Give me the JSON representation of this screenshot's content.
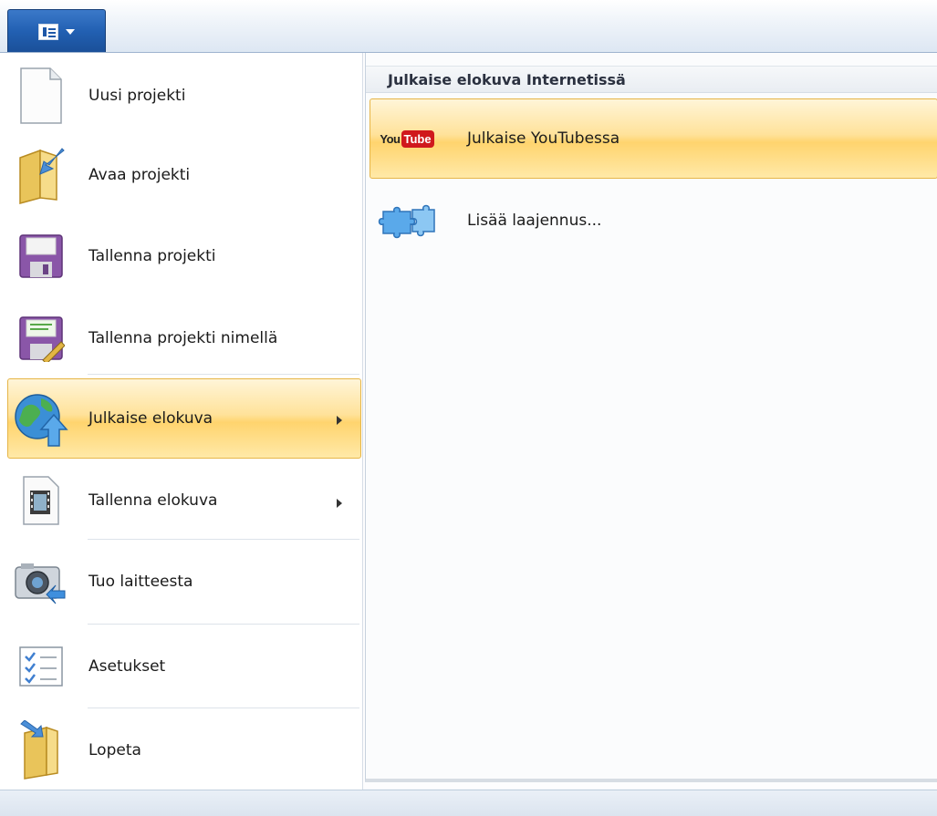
{
  "app_menu": {
    "button_icon": "document-menu-icon"
  },
  "left_menu": {
    "items": [
      {
        "label": "Uusi projekti",
        "icon": "new-document-icon"
      },
      {
        "label": "Avaa projekti",
        "icon": "open-folder-icon"
      },
      {
        "label": "Tallenna projekti",
        "icon": "save-floppy-icon"
      },
      {
        "label": "Tallenna projekti nimellä",
        "icon": "save-as-icon"
      },
      {
        "label": "Julkaise elokuva",
        "icon": "publish-globe-icon",
        "active": true,
        "has_submenu": true
      },
      {
        "label": "Tallenna elokuva",
        "icon": "film-document-icon",
        "has_submenu": true
      },
      {
        "label": "Tuo laitteesta",
        "icon": "camera-import-icon"
      },
      {
        "label": "Asetukset",
        "icon": "options-checklist-icon"
      },
      {
        "label": "Lopeta",
        "icon": "exit-folder-icon"
      }
    ]
  },
  "submenu": {
    "header": "Julkaise elokuva Internetissä",
    "items": [
      {
        "label": "Julkaise YouTubessa",
        "icon": "youtube-logo-icon",
        "active": true,
        "logo_you": "You",
        "logo_tube": "Tube"
      },
      {
        "label": "Lisää laajennus...",
        "icon": "puzzle-plugin-icon"
      }
    ]
  },
  "colors": {
    "highlight_border": "#e6b547",
    "highlight_fill": "#ffd46e",
    "app_button": "#2260b2"
  }
}
